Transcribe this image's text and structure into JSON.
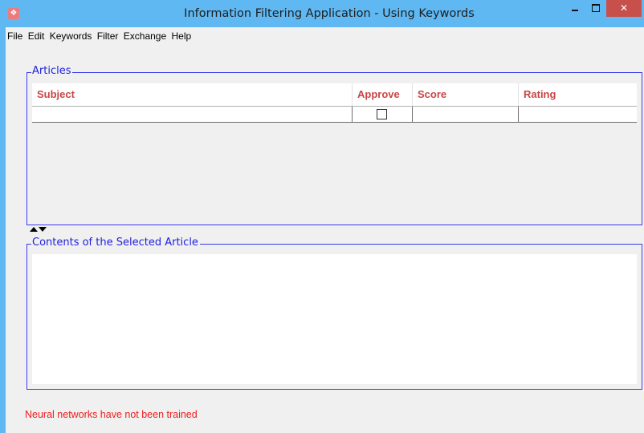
{
  "window": {
    "title": "Information Filtering Application - Using Keywords",
    "icon": "app-icon",
    "close_glyph": "✕"
  },
  "menu": {
    "items": [
      "File",
      "Edit",
      "Keywords",
      "Filter",
      "Exchange",
      "Help"
    ]
  },
  "articles": {
    "group_label": "Articles",
    "columns": [
      "Subject",
      "Approve",
      "Score",
      "Rating"
    ],
    "rows": [
      {
        "subject": "",
        "approve": false,
        "score": "",
        "rating": ""
      }
    ]
  },
  "contents": {
    "group_label": "Contents of the Selected Article",
    "text": ""
  },
  "status": {
    "message": "Neural networks have not been trained"
  },
  "colors": {
    "titlebar": "#5fb8f1",
    "close_button": "#c7504d",
    "group_border": "#3a3aee",
    "group_label": "#2020e0",
    "column_header": "#c94545",
    "status_text": "#ee1c1c"
  }
}
